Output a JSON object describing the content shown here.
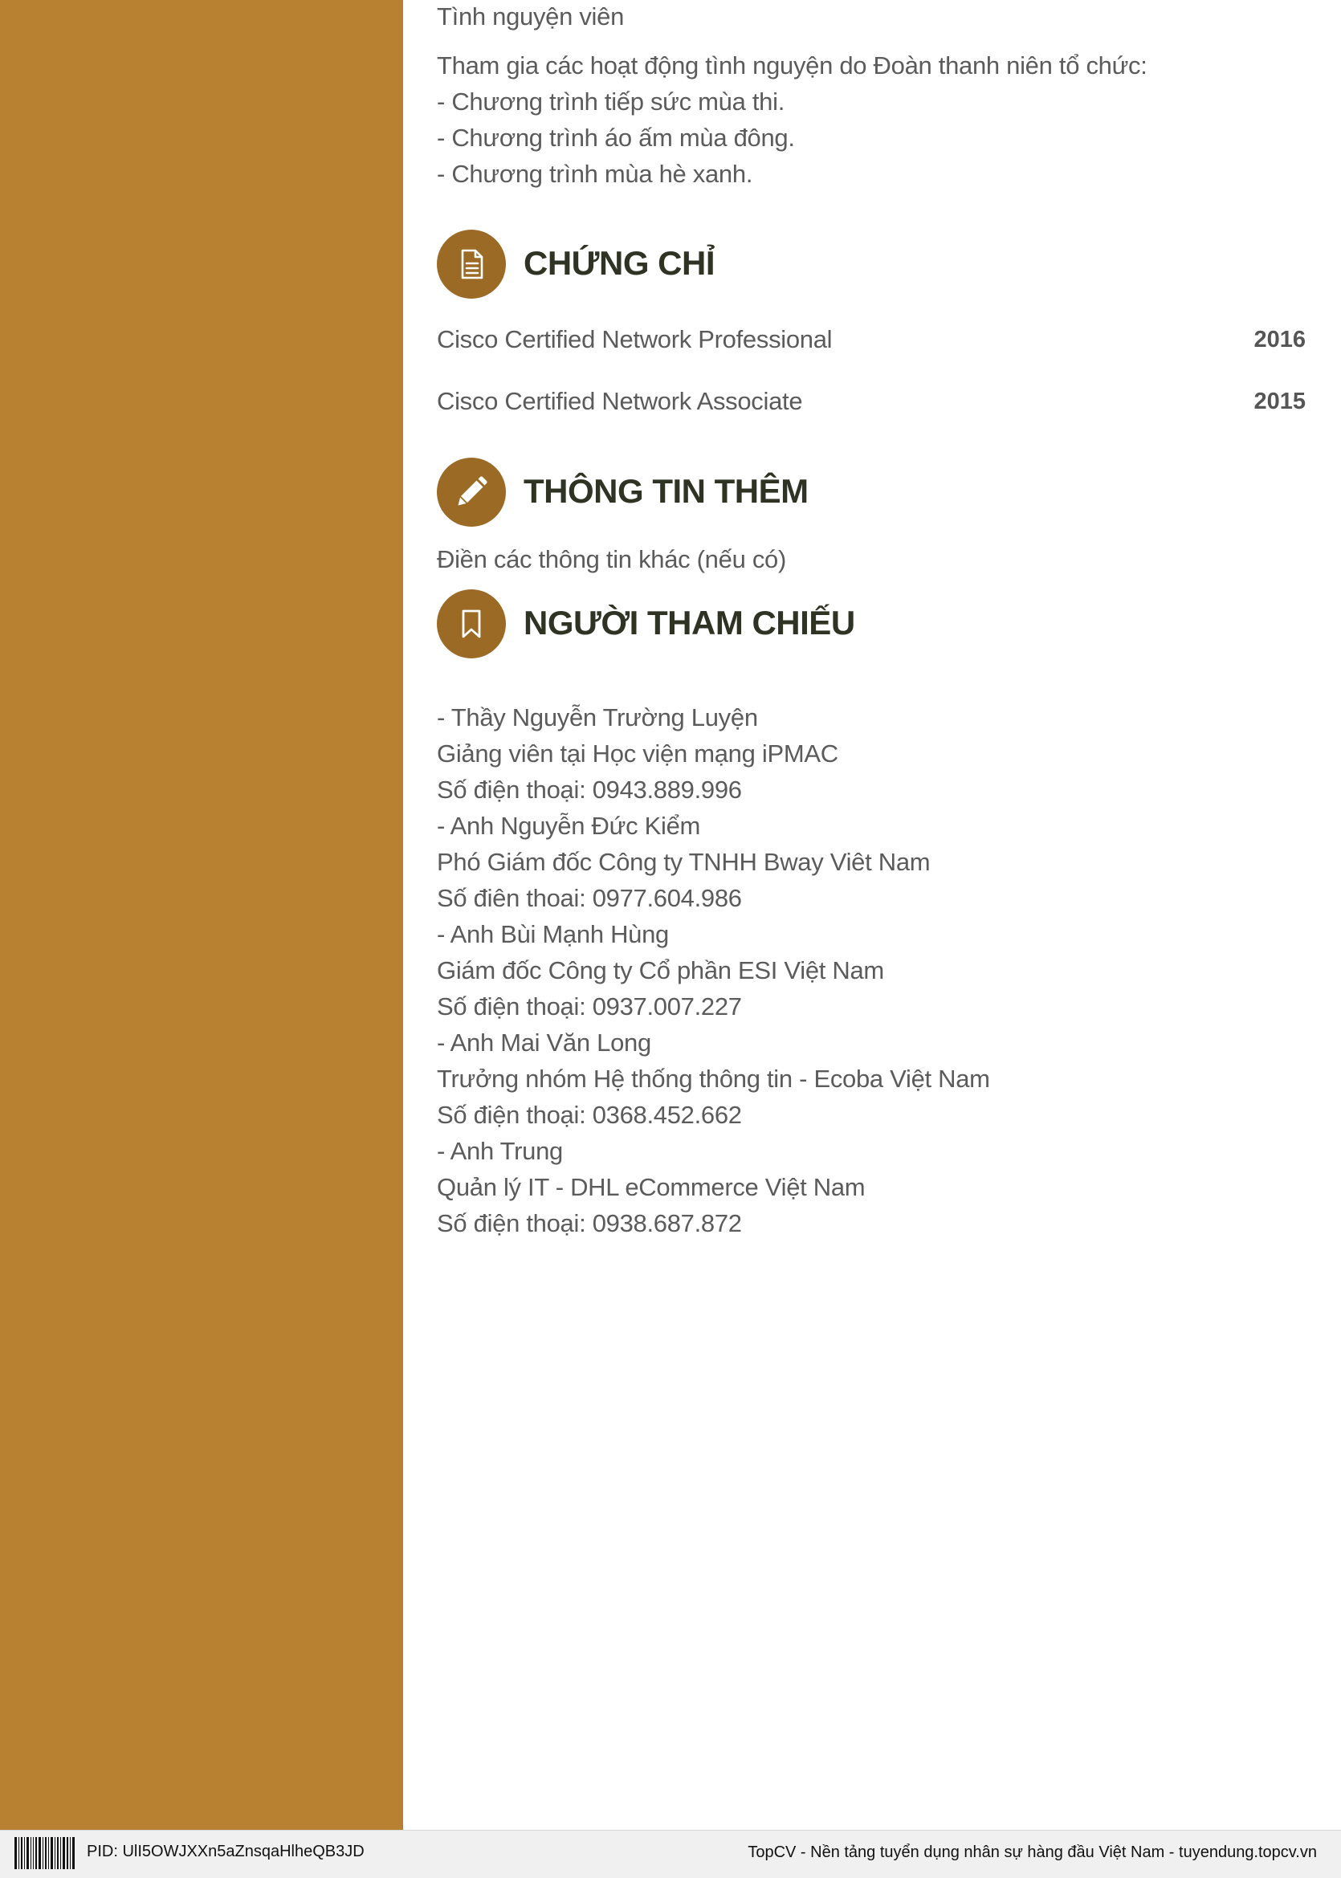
{
  "activity": {
    "title": "Tình nguyện viên",
    "lines": [
      "Tham gia các hoạt động tình nguyện do Đoàn thanh niên tổ chức:",
      "- Chương trình tiếp sức mùa thi.",
      "- Chương trình áo ấm mùa đông.",
      "- Chương trình mùa hè xanh."
    ]
  },
  "certificates": {
    "title": "CHỨNG CHỈ",
    "icon": "document-icon",
    "items": [
      {
        "name": "Cisco Certified Network Professional",
        "year": "2016"
      },
      {
        "name": "Cisco Certified Network Associate",
        "year": "2015"
      }
    ]
  },
  "additional_info": {
    "title": "THÔNG TIN THÊM",
    "icon": "pencil-icon",
    "text": "Điền các thông tin khác (nếu có)"
  },
  "references": {
    "title": "NGƯỜI THAM CHIẾU",
    "icon": "bookmark-icon",
    "lines": [
      "- Thầy Nguyễn Trường Luyện",
      "Giảng viên tại Học viện mạng iPMAC",
      "Số điện thoại: 0943.889.996",
      "- Anh Nguyễn Đức Kiểm",
      "Phó Giám đốc Công ty TNHH Bway Viêt Nam",
      "Số điên thoai:  0977.604.986",
      "- Anh Bùi Mạnh Hùng",
      "Giám đốc Công ty Cổ phần ESI Việt Nam",
      "Số điện thoại: 0937.007.227",
      "- Anh Mai Văn Long",
      "Trưởng nhóm Hệ thống thông tin - Ecoba Việt Nam",
      "Số điện thoại: 0368.452.662",
      "- Anh Trung",
      "Quản lý IT - DHL eCommerce Việt Nam",
      "Số điện thoại: 0938.687.872"
    ]
  },
  "footer": {
    "pid": "PID: UlI5OWJXXn5aZnsqaHlheQB3JD",
    "right_text": "TopCV - Nền tảng tuyển dụng nhân sự hàng đầu Việt Nam - tuyendung.topcv.vn"
  },
  "colors": {
    "sidebar": "#b88132",
    "icon_circle": "#9b6a25",
    "heading": "#2f3324"
  }
}
